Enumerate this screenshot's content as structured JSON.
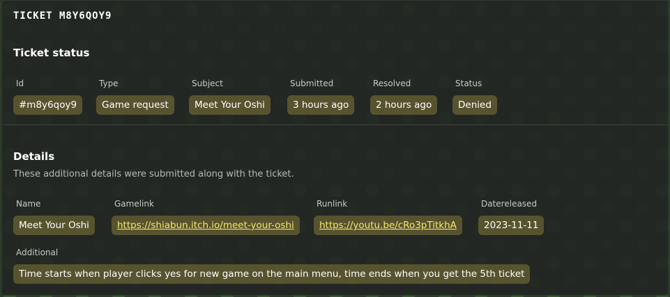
{
  "panel": {
    "title": "TICKET M8Y6QOY9"
  },
  "status_section": {
    "heading": "Ticket status",
    "fields": [
      {
        "label": "Id",
        "value": "#m8y6qoy9"
      },
      {
        "label": "Type",
        "value": "Game request"
      },
      {
        "label": "Subject",
        "value": "Meet Your Oshi"
      },
      {
        "label": "Submitted",
        "value": "3 hours ago"
      },
      {
        "label": "Resolved",
        "value": "2 hours ago"
      },
      {
        "label": "Status",
        "value": "Denied"
      }
    ]
  },
  "details_section": {
    "heading": "Details",
    "description": "These additional details were submitted along with the ticket.",
    "fields": [
      {
        "label": "Name",
        "value": "Meet Your Oshi"
      },
      {
        "label": "Gamelink",
        "value": "https://shiabun.itch.io/meet-your-oshi"
      },
      {
        "label": "Runlink",
        "value": "https://youtu.be/cRo3pTitkhA"
      },
      {
        "label": "Datereleased",
        "value": "2023-11-11"
      },
      {
        "label": "Additional",
        "value": "Time starts when player clicks yes for new game on the main menu, time ends when you get the 5th ticket"
      }
    ]
  },
  "colors": {
    "panel_bg": "#222622",
    "value_bg": "#787037",
    "link": "#f6e76a",
    "label": "#c7cbc4"
  }
}
